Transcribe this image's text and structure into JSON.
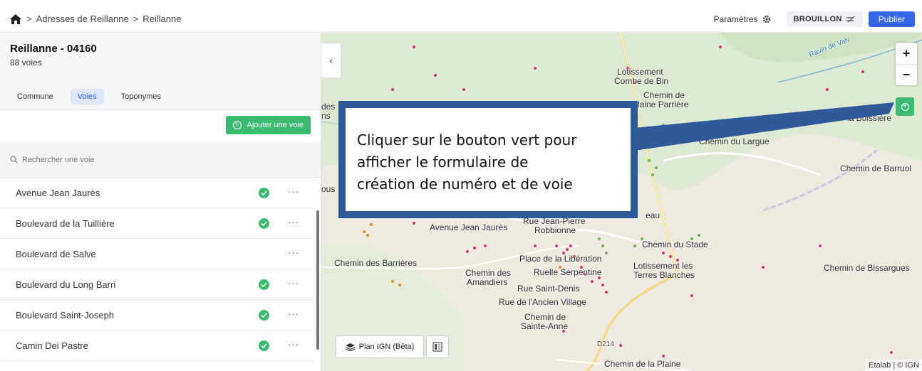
{
  "breadcrumb": {
    "items": [
      "Adresses de Reillanne",
      "Reillanne"
    ],
    "separator": ">"
  },
  "header": {
    "settings_label": "Paramètres",
    "draft_label": "BROUILLON",
    "publish_label": "Publier"
  },
  "colors": {
    "accent": "#3566e8",
    "green": "#3cba72",
    "callout_border": "#2e5a9a"
  },
  "commune": {
    "title": "Reillanne - 04160",
    "count": "88 voies"
  },
  "tabs": [
    {
      "label": "Commune",
      "active": false
    },
    {
      "label": "Voies",
      "active": true
    },
    {
      "label": "Toponymes",
      "active": false
    }
  ],
  "add_voie_label": "Ajouter une voie",
  "search": {
    "placeholder": "Rechercher une voie"
  },
  "voies": [
    {
      "label": "Avenue Jean Jaurès",
      "certified": true
    },
    {
      "label": "Boulevard de la Tuillière",
      "certified": true
    },
    {
      "label": "Boulevard de Salve",
      "certified": false
    },
    {
      "label": "Boulevard du Long Barri",
      "certified": true
    },
    {
      "label": "Boulevard Saint-Joseph",
      "certified": true
    },
    {
      "label": "Camin Dei Pastre",
      "certified": true
    }
  ],
  "map": {
    "labels": [
      "Lotissement",
      "Combe de Bin",
      "Chemin de",
      "Plaine Parrière",
      "Chemin du Largue",
      "Chemin de Barruol",
      "Avenue Jean Jaurès",
      "Rue Jean-Pierre",
      "Robbionne",
      "Chemin du Stade",
      "Place de la Libération",
      "Chemin des Barrières",
      "Lotissement les",
      "Terres Blanches",
      "Chemin de Bissargues",
      "Chemin des",
      "Amandiers",
      "Ruelle Serpentine",
      "Rue Saint-Denis",
      "Rue de l'Ancien Village",
      "Chemin de",
      "Sainte-Anne",
      "D214",
      "Chemin de la Plaine",
      "Ravin de Valv",
      "la Buissière",
      "des",
      "ns",
      "ous",
      "eau"
    ],
    "layer_label": "Plan IGN (Bêta)",
    "attribution": "Etalab | © IGN"
  },
  "callout": {
    "lines": [
      "Cliquer sur le bouton vert pour",
      "afficher le formulaire de",
      "création de numéro et de voie"
    ]
  }
}
